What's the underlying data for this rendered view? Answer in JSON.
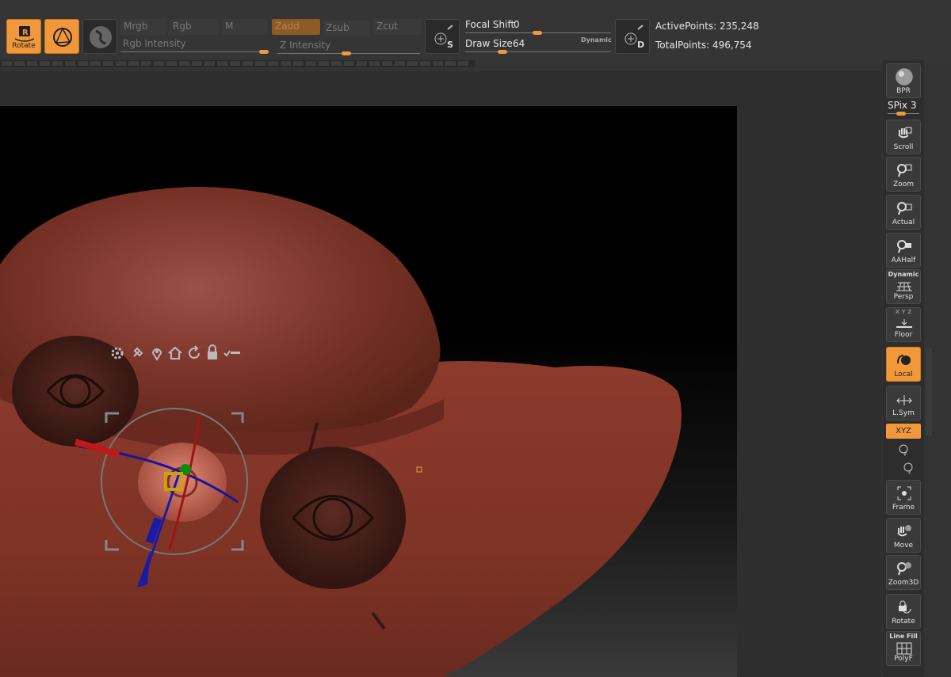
{
  "toolbar": {
    "rotate_label": "Rotate",
    "mrgb": "Mrgb",
    "rgb": "Rgb",
    "m": "M",
    "zadd": "Zadd",
    "zsub": "Zsub",
    "zcut": "Zcut",
    "rgb_intensity_label": "Rgb Intensity",
    "z_intensity_label": "Z Intensity",
    "focal_shift_label": "Focal Shift",
    "focal_shift_value": "0",
    "draw_size_label": "Draw Size",
    "draw_size_value": "64",
    "dynamic_label": "Dynamic",
    "active_points": "ActivePoints: 235,248",
    "total_points": "TotalPoints: 496,754",
    "s_label": "S",
    "d_label": "D"
  },
  "gizmo_icons": [
    "gear-icon",
    "pin-icon",
    "location-icon",
    "home-icon",
    "reset-icon",
    "lock-icon",
    "toggle-icon"
  ],
  "shelf": {
    "bpr": "BPR",
    "spix": "SPix 3",
    "scroll": "Scroll",
    "zoom": "Zoom",
    "actual": "Actual",
    "aahalf": "AAHalf",
    "persp_top": "Dynamic",
    "persp": "Persp",
    "floor": "Floor",
    "floor_axes": "X Y Z",
    "local": "Local",
    "lsym": "L.Sym",
    "xyz": "XYZ",
    "frame": "Frame",
    "move": "Move",
    "zoom3d": "Zoom3D",
    "rotate": "Rotate",
    "polyf_top": "Line Fill",
    "polyf": "PolyF"
  },
  "colors": {
    "accent": "#f1993a",
    "hat": "#8a3a2c"
  }
}
